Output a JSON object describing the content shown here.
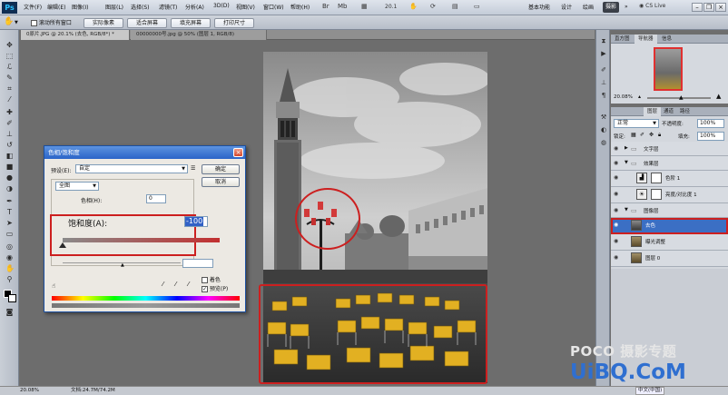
{
  "menubar": {
    "items": [
      "文件(F)",
      "编辑(E)",
      "图像(I)",
      "图层(L)",
      "选择(S)",
      "滤镜(T)",
      "分析(A)",
      "3D(D)",
      "视图(V)",
      "窗口(W)",
      "帮助(H)"
    ],
    "zoom": "20.1",
    "workspaces": [
      "基本功能",
      "设计",
      "绘画"
    ],
    "workspace_active": "摄影",
    "cs_live": "CS Live"
  },
  "options": {
    "scroll_all_label": "滚动所有窗口",
    "actual_pixels": "实际像素",
    "fit_screen": "适合屏幕",
    "fill_screen": "填充屏幕",
    "print_size": "打印尺寸"
  },
  "tabs": [
    {
      "label": "0原片.JPG @ 20.1% (去色, RGB/8*) *"
    },
    {
      "label": "00000000号.jpg @ 50% (图层 1, RGB/8)"
    }
  ],
  "dialog": {
    "title": "色相/饱和度",
    "preset_label": "预设(E):",
    "preset_value": "自定",
    "ok": "确定",
    "cancel": "取消",
    "channel": "全图",
    "hue_label": "色相(H):",
    "hue_value": "0",
    "saturation_label": "饱和度(A):",
    "saturation_value": "-100",
    "saturation_fraction": 0.0,
    "colorize_label": "着色",
    "preview_label": "预览(P)"
  },
  "navigator": {
    "tabs": [
      "直方图",
      "导航器",
      "信息"
    ],
    "active_tab": "导航器",
    "zoom": "20.08%"
  },
  "layers": {
    "tabs": [
      "图层",
      "通道",
      "路径"
    ],
    "active_tab": "图层",
    "blend_mode": "正常",
    "opacity_label": "不透明度:",
    "opacity": "100%",
    "lock_label": "锁定:",
    "fill_label": "填充:",
    "fill": "100%",
    "items": [
      {
        "name": "文字层",
        "kind": "group"
      },
      {
        "name": "效果层",
        "kind": "group"
      },
      {
        "name": "色阶 1",
        "kind": "adjust"
      },
      {
        "name": "亮度/对比度 1",
        "kind": "adjust"
      },
      {
        "name": "图像层",
        "kind": "group"
      },
      {
        "name": "去色",
        "kind": "layer",
        "selected": true
      },
      {
        "name": "曝光调整",
        "kind": "layer"
      },
      {
        "name": "图层 0",
        "kind": "layer"
      }
    ]
  },
  "status": {
    "zoom": "20.08%",
    "doc": "文档:24.7M/74.2M",
    "ime": "中文(中国)"
  },
  "watermark": {
    "poco": "POCO 摄影专题",
    "uibq": "UiBQ.CoM"
  },
  "colors": {
    "highlight_red": "#cc1f1f",
    "selected_layer": "#3b6fc4",
    "dialog_title": "#2a64c8"
  }
}
